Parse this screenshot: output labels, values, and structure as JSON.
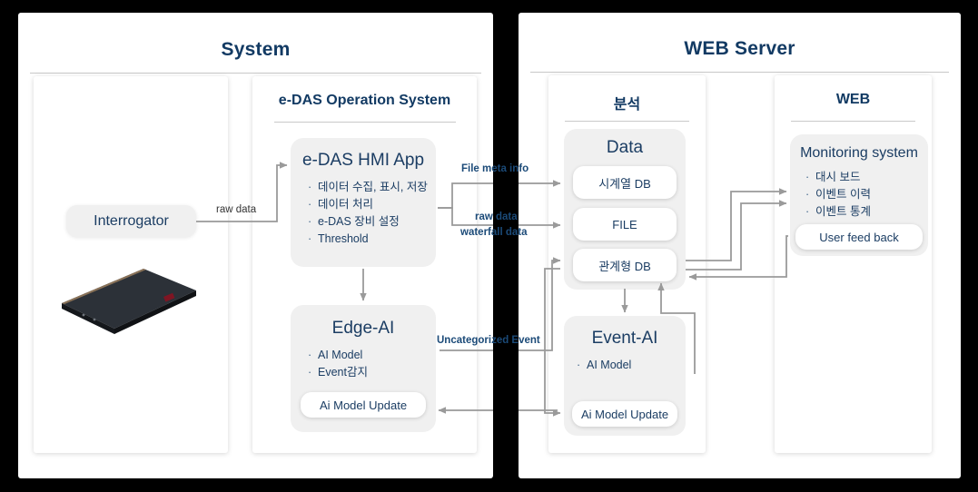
{
  "diagram": {
    "panels": [
      {
        "id": "system",
        "title": "System"
      },
      {
        "id": "web_server",
        "title": "WEB Server"
      }
    ],
    "system": {
      "left_subpanel": {
        "interrogator_label": "Interrogator",
        "device_image_name": "rack-server-photo"
      },
      "right_subpanel": {
        "title": "e-DAS Operation System",
        "hmi_card": {
          "title": "e-DAS HMI App",
          "bullets": [
            "데이터 수집, 표시, 저장",
            "데이터 처리",
            "e-DAS 장비 설정",
            "Threshold"
          ]
        },
        "edge_ai_card": {
          "title": "Edge-AI",
          "bullets": [
            "AI Model",
            "Event감지"
          ],
          "pill": "Ai Model Update"
        }
      }
    },
    "web_server": {
      "analysis_subpanel": {
        "title": "분석",
        "data_card": {
          "title": "Data",
          "items": [
            "시계열 DB",
            "FILE",
            "관계형 DB"
          ]
        },
        "event_ai_card": {
          "title": "Event-AI",
          "bullets": [
            "AI Model"
          ],
          "pill": "Ai Model Update"
        }
      },
      "web_subpanel": {
        "title": "WEB",
        "monitoring_card": {
          "title": "Monitoring system",
          "bullets": [
            "대시 보드",
            "이벤트 이력",
            "이벤트 통계"
          ],
          "pill": "User feed back"
        }
      }
    },
    "connector_labels": [
      {
        "id": "raw_data_left",
        "text": "raw data"
      },
      {
        "id": "file_meta_info",
        "text": "File meta info"
      },
      {
        "id": "raw_data_right",
        "text": "raw data"
      },
      {
        "id": "waterfall_data",
        "text": "waterfall data"
      },
      {
        "id": "uncategorized_event",
        "text": "Uncategorized Event"
      }
    ],
    "colors": {
      "title_navy": "#123a63",
      "text_navy": "#1b3d63",
      "label_blue": "#1b4a78",
      "card_gray": "#f0f0f0",
      "wire_gray": "#9a9a9a",
      "background": "#000000"
    }
  }
}
